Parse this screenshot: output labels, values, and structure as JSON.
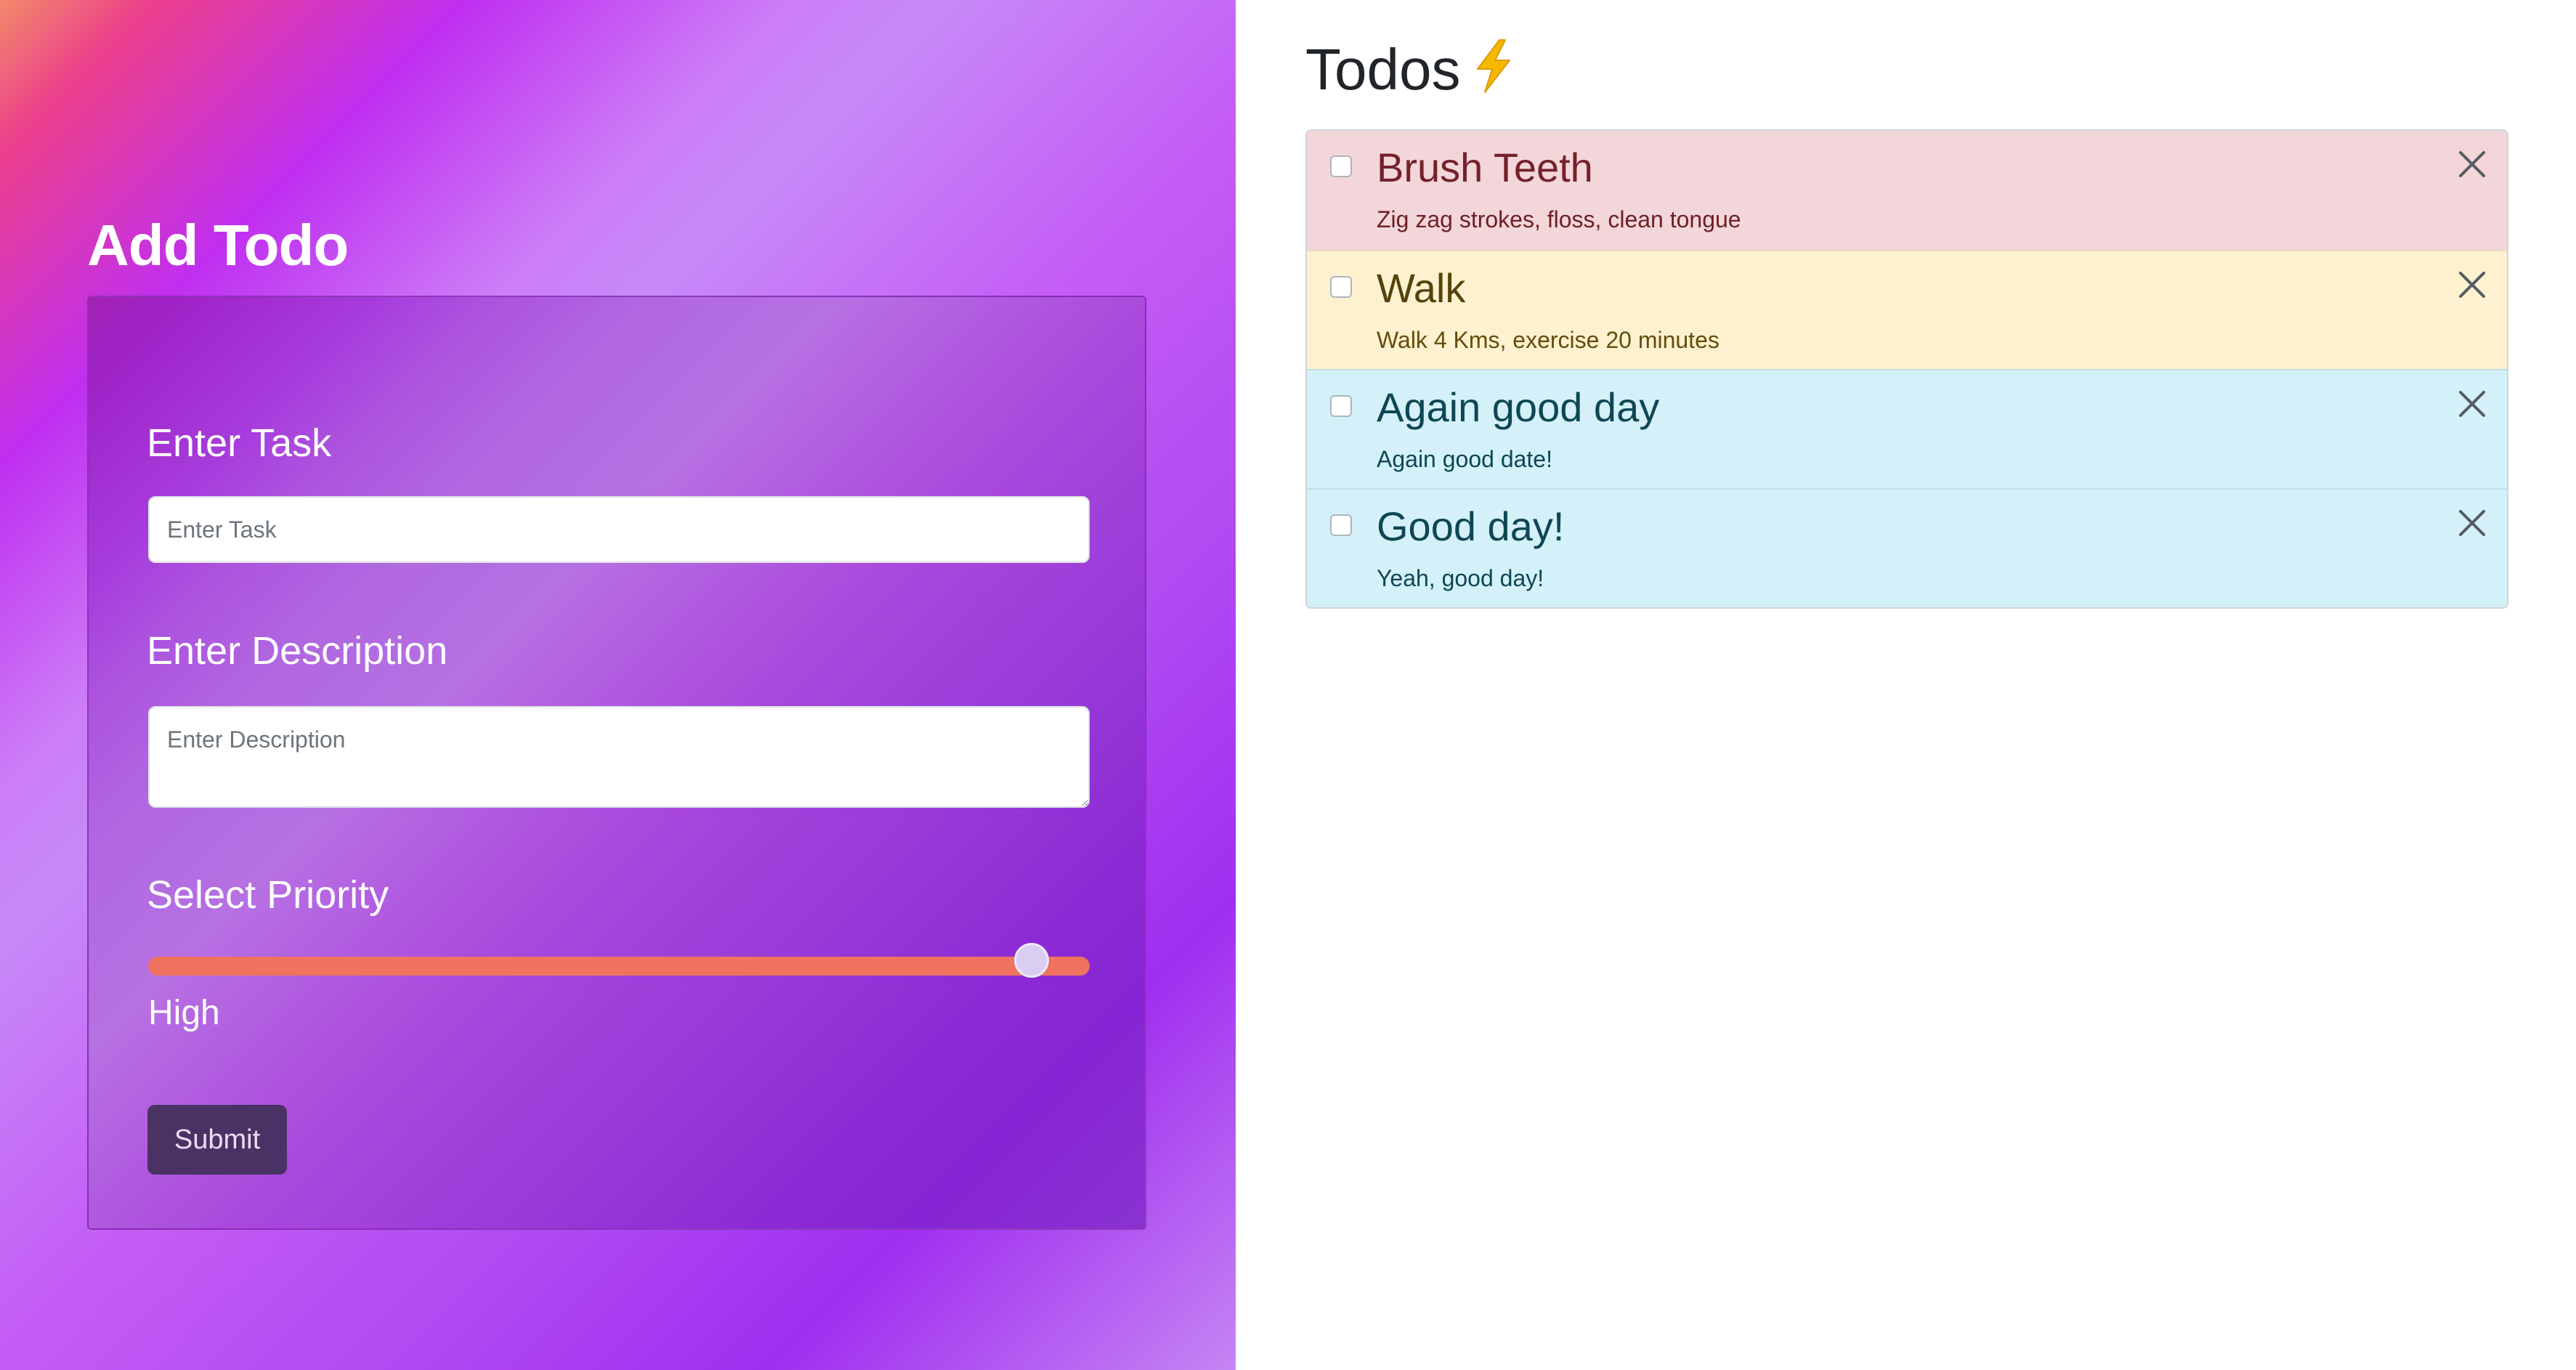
{
  "add_form": {
    "title": "Add Todo",
    "task_label": "Enter Task",
    "task_placeholder": "Enter Task",
    "task_value": "",
    "description_label": "Enter Description",
    "description_placeholder": "Enter Description",
    "description_value": "",
    "priority_label": "Select Priority",
    "priority_value": "High",
    "priority_level": 1.0,
    "submit_label": "Submit"
  },
  "todos_panel": {
    "title": "Todos",
    "title_icon": "lightning-bolt-icon",
    "items": [
      {
        "title": "Brush Teeth",
        "description": "Zig zag strokes, floss, clean tongue",
        "checked": false,
        "variant": "danger"
      },
      {
        "title": "Walk",
        "description": "Walk 4 Kms, exercise 20 minutes",
        "checked": false,
        "variant": "warning"
      },
      {
        "title": "Again good day",
        "description": "Again good date!",
        "checked": false,
        "variant": "info"
      },
      {
        "title": "Good day!",
        "description": "Yeah, good day!",
        "checked": false,
        "variant": "info"
      }
    ]
  },
  "colors": {
    "slider_fill": "#f07360",
    "submit_bg": "#4b3264",
    "danger_bg": "#f3d6d9",
    "warning_bg": "#fdf1cf",
    "info_bg": "#d4f1f9",
    "bolt": "#f5b800"
  }
}
